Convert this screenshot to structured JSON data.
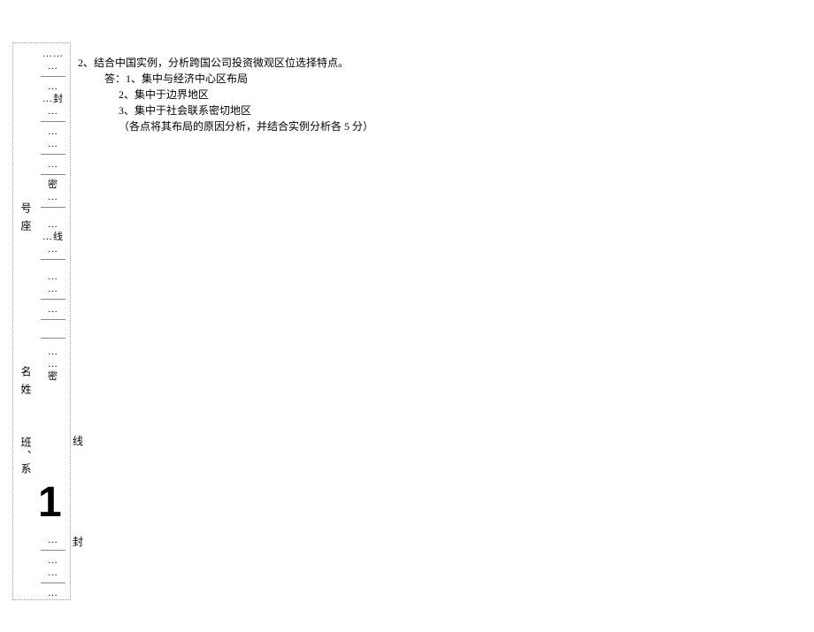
{
  "sidebar": {
    "dots6": "……",
    "dots3": "…",
    "dots3_feng": "…封",
    "mi": "密",
    "dots3_xian": "…线",
    "label_hao": "号",
    "label_zuo": "座",
    "label_ming": "名",
    "label_xing": "姓",
    "label_ban": "班",
    "label_dun": "、",
    "label_xi": "系",
    "big_number": "1",
    "right_xian": "线",
    "right_feng": "封"
  },
  "content": {
    "question": "2、结合中国实例，分析跨国公司投资微观区位选择特点。",
    "answer_prefix": "答：",
    "point1": "1、集中与经济中心区布局",
    "point2": "2、集中于边界地区",
    "point3": "3、集中于社会联系密切地区",
    "note": "（各点将其布局的原因分析，并结合实例分析各 5 分）"
  }
}
